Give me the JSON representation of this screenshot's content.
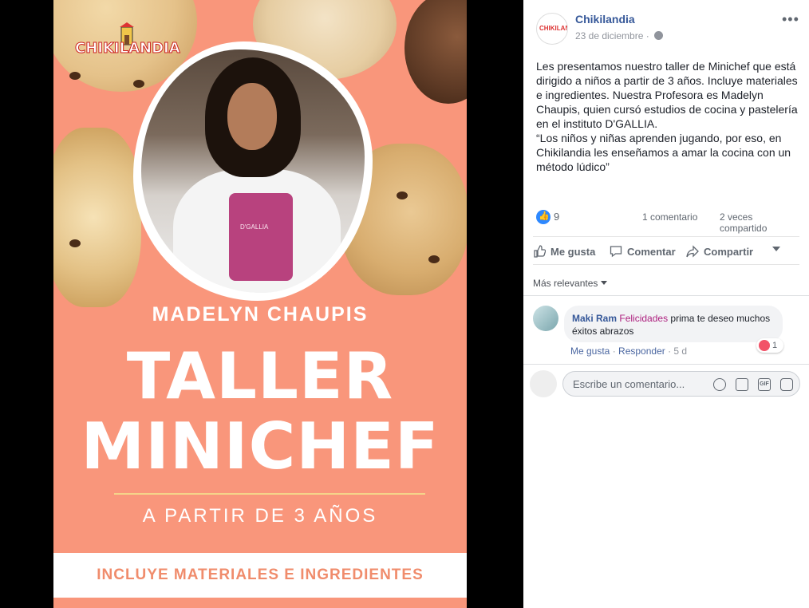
{
  "poster": {
    "logo_text": "CHIKILANDIA",
    "subtitle": "MADELYN CHAUPIS",
    "title_line1": "TALLER",
    "title_line2": "MINICHEF",
    "age": "A PARTIR DE 3 AÑOS",
    "banner": "INCLUYE MATERIALES E INGREDIENTES",
    "apron_text": "D'GALLIA",
    "colors": {
      "background": "#f9967b",
      "banner_text": "#f08c6c",
      "rule": "#f5d38a"
    }
  },
  "post": {
    "page_name": "Chikilandia",
    "date": "23 de diciembre",
    "caption": [
      "Les presentamos nuestro taller de Minichef que está dirigido a niños a partir de 3 años. Incluye materiales e ingredientes. Nuestra Profesora es Madelyn Chaupis, quien cursó estudios de cocina y pastelería en el instituto D'GALLIA.",
      "“Los niños y niñas aprenden jugando, por eso, en Chikilandia les enseñamos a amar la cocina con un método lúdico”"
    ],
    "like_count": "9",
    "comment_count": "1 comentario",
    "share_count": "2 veces compartido"
  },
  "actions": {
    "like": "Me gusta",
    "comment": "Comentar",
    "share": "Compartir"
  },
  "comments": {
    "sort_label": "Más relevantes",
    "items": [
      {
        "author": "Maki Ram",
        "tagged": "Felicidades",
        "text": " prima te deseo muchos éxitos abrazos",
        "reaction_count": "1",
        "like_label": "Me gusta",
        "reply_label": "Responder",
        "age": "5 d"
      }
    ],
    "write_placeholder": "Escribe un comentario...",
    "gif_label": "GIF"
  },
  "icons": [
    "more-icon",
    "globe-icon",
    "like-reaction-icon",
    "like-icon",
    "comment-icon",
    "share-icon",
    "audience-caret-icon",
    "love-reaction-icon",
    "emoji-icon",
    "camera-icon",
    "gif-icon",
    "sticker-icon"
  ]
}
